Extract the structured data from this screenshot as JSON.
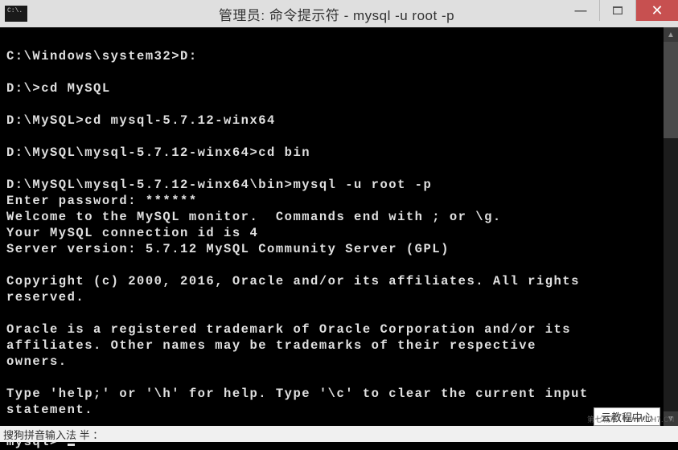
{
  "window": {
    "title": "管理员: 命令提示符 - mysql  -u root -p"
  },
  "terminal": {
    "lines": "\nC:\\Windows\\system32>D:\n\nD:\\>cd MySQL\n\nD:\\MySQL>cd mysql-5.7.12-winx64\n\nD:\\MySQL\\mysql-5.7.12-winx64>cd bin\n\nD:\\MySQL\\mysql-5.7.12-winx64\\bin>mysql -u root -p\nEnter password: ******\nWelcome to the MySQL monitor.  Commands end with ; or \\g.\nYour MySQL connection id is 4\nServer version: 5.7.12 MySQL Community Server (GPL)\n\nCopyright (c) 2000, 2016, Oracle and/or its affiliates. All rights reserved.\n\nOracle is a registered trademark of Oracle Corporation and/or its\naffiliates. Other names may be trademarks of their respective\nowners.\n\nType 'help;' or '\\h' for help. Type '\\c' to clear the current input statement.\n\nmysql> "
  },
  "statusbar": {
    "ime": "搜狗拼音输入法 半 ："
  },
  "watermark": {
    "center": "云教程中心",
    "right_a": "第七城市",
    "right_b": "WWW.TH7.CN"
  }
}
